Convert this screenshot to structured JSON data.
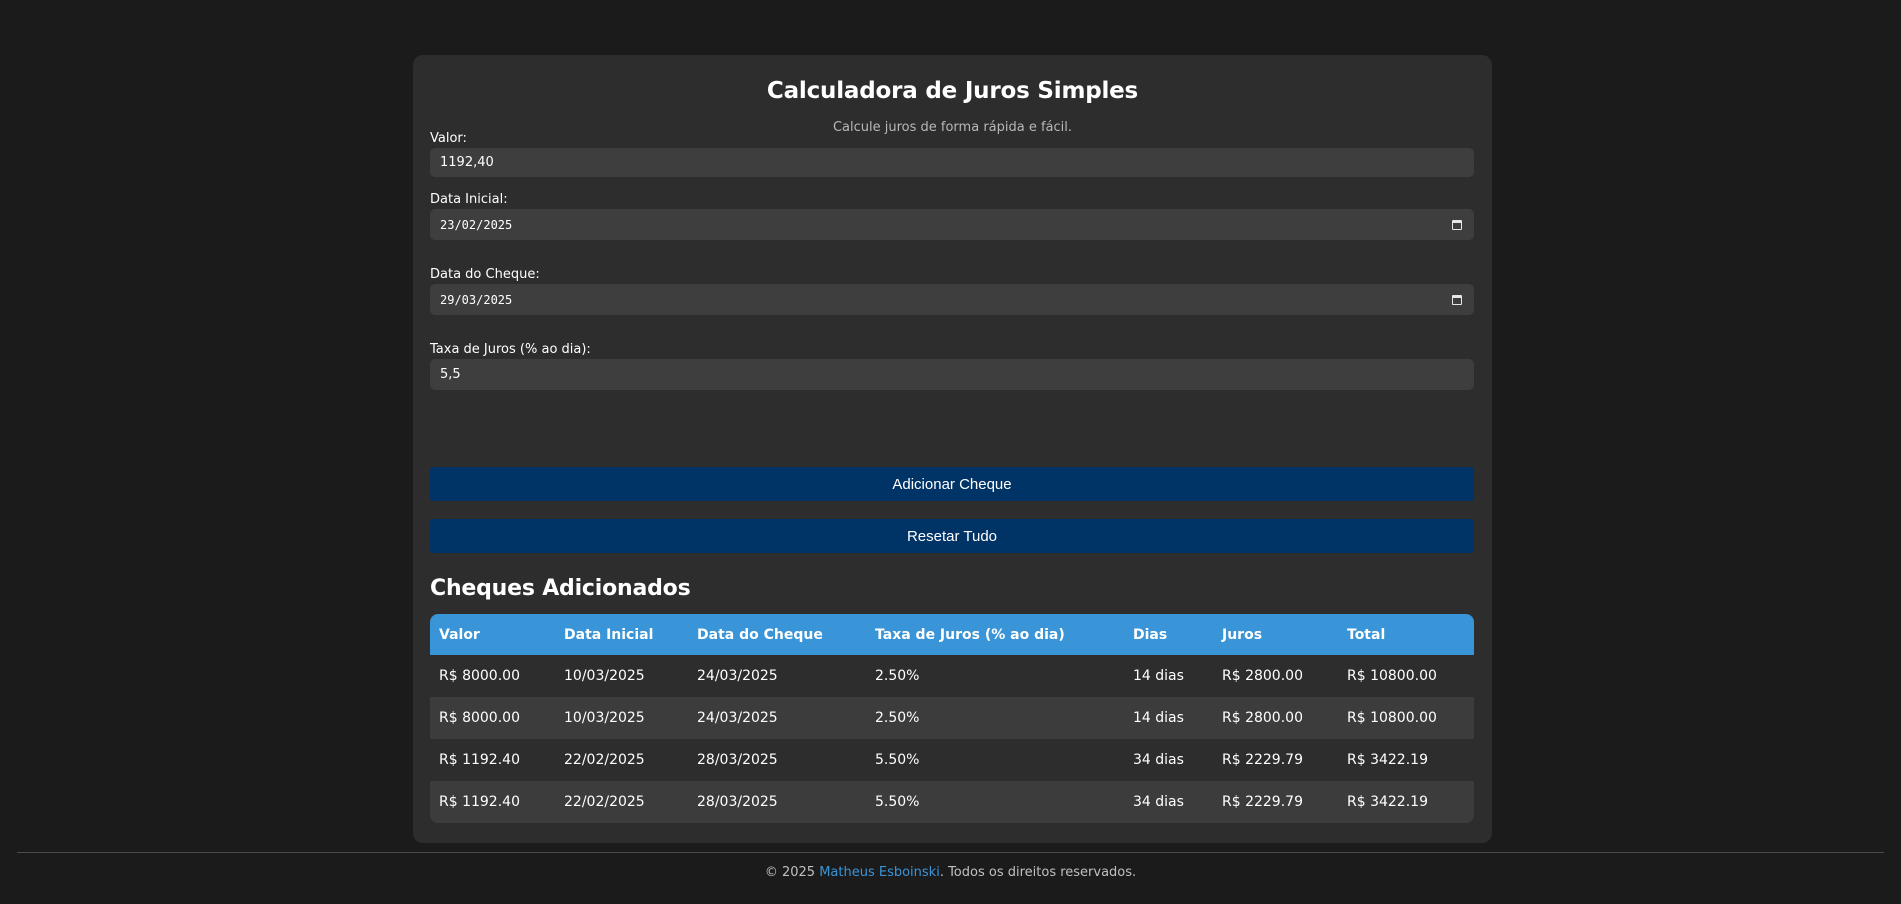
{
  "header": {
    "title": "Calculadora de Juros Simples",
    "subtitle": "Calcule juros de forma rápida e fácil."
  },
  "form": {
    "valor_label": "Valor:",
    "valor_value": "1192,40",
    "data_inicial_label": "Data Inicial:",
    "data_inicial_value": "23/02/2025",
    "data_cheque_label": "Data do Cheque:",
    "data_cheque_value": "29/03/2025",
    "taxa_label": "Taxa de Juros (% ao dia):",
    "taxa_value": "5,5"
  },
  "buttons": {
    "add_label": "Adicionar Cheque",
    "reset_label": "Resetar Tudo"
  },
  "section": {
    "title": "Cheques Adicionados"
  },
  "table": {
    "headers": [
      "Valor",
      "Data Inicial",
      "Data do Cheque",
      "Taxa de Juros (% ao dia)",
      "Dias",
      "Juros",
      "Total"
    ],
    "rows": [
      [
        "R$ 8000.00",
        "10/03/2025",
        "24/03/2025",
        "2.50%",
        "14 dias",
        "R$ 2800.00",
        "R$ 10800.00"
      ],
      [
        "R$ 8000.00",
        "10/03/2025",
        "24/03/2025",
        "2.50%",
        "14 dias",
        "R$ 2800.00",
        "R$ 10800.00"
      ],
      [
        "R$ 1192.40",
        "22/02/2025",
        "28/03/2025",
        "5.50%",
        "34 dias",
        "R$ 2229.79",
        "R$ 3422.19"
      ],
      [
        "R$ 1192.40",
        "22/02/2025",
        "28/03/2025",
        "5.50%",
        "34 dias",
        "R$ 2229.79",
        "R$ 3422.19"
      ]
    ]
  },
  "footer": {
    "prefix": "© 2025 ",
    "author": "Matheus Esboinski",
    "suffix": ". Todos os direitos reservados."
  },
  "colors": {
    "background": "#1b1b1b",
    "card": "#2d2d2d",
    "input": "#3e3e3e",
    "button": "#003366",
    "table_header": "#3a95d8",
    "link": "#3a95d8"
  },
  "icons": {
    "date_picker": "calendar-icon"
  }
}
